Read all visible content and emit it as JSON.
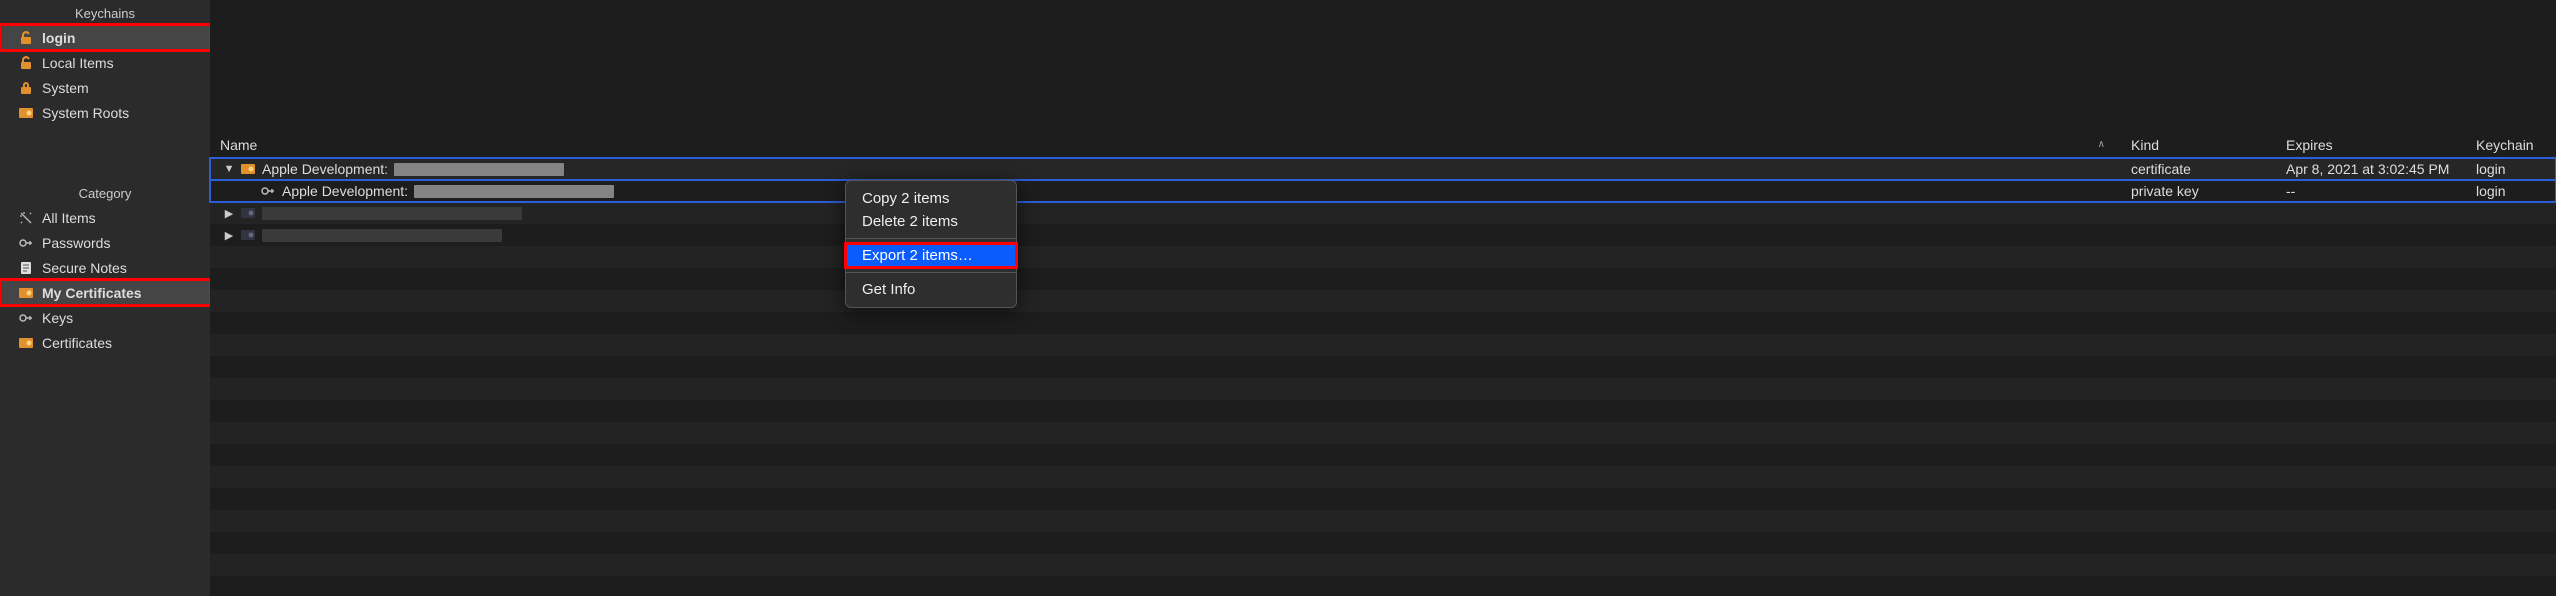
{
  "sidebar": {
    "sections": [
      {
        "title": "Keychains",
        "items": [
          {
            "icon": "unlock",
            "label": "login",
            "selected": true,
            "highlight": true
          },
          {
            "icon": "unlock",
            "label": "Local Items"
          },
          {
            "icon": "lock",
            "label": "System"
          },
          {
            "icon": "cert",
            "label": "System Roots"
          }
        ]
      },
      {
        "title": "Category",
        "items": [
          {
            "icon": "wand",
            "label": "All Items"
          },
          {
            "icon": "key",
            "label": "Passwords"
          },
          {
            "icon": "note",
            "label": "Secure Notes"
          },
          {
            "icon": "cert",
            "label": "My Certificates",
            "selected": true,
            "highlight": true
          },
          {
            "icon": "key",
            "label": "Keys"
          },
          {
            "icon": "cert",
            "label": "Certificates"
          }
        ]
      }
    ]
  },
  "table": {
    "columns": {
      "name": "Name",
      "kind": "Kind",
      "expires": "Expires",
      "keychain": "Keychain"
    },
    "rows": [
      {
        "name": "Apple Development:",
        "redacted": true,
        "depth": 0,
        "icon": "cert",
        "expanded": true,
        "kind": "certificate",
        "expires": "Apr 8, 2021 at 3:02:45 PM",
        "keychain": "login",
        "selected": true
      },
      {
        "name": "Apple Development:",
        "redacted": true,
        "depth": 1,
        "icon": "key",
        "kind": "private key",
        "expires": "--",
        "keychain": "login",
        "selected": true
      },
      {
        "name": "",
        "redacted": true,
        "depth": 0,
        "icon": "cert",
        "kind": "",
        "expires": "",
        "keychain": "",
        "hiddenRow": true
      },
      {
        "name": "",
        "redacted": true,
        "depth": 0,
        "icon": "cert",
        "kind": "",
        "expires": "",
        "keychain": "",
        "hiddenRow": true
      }
    ]
  },
  "context_menu": {
    "items": [
      {
        "label": "Copy 2 items"
      },
      {
        "label": "Delete 2 items"
      },
      {
        "sep": true
      },
      {
        "label": "Export 2 items…",
        "selected": true,
        "highlight": true
      },
      {
        "sep": true
      },
      {
        "label": "Get Info"
      }
    ]
  }
}
